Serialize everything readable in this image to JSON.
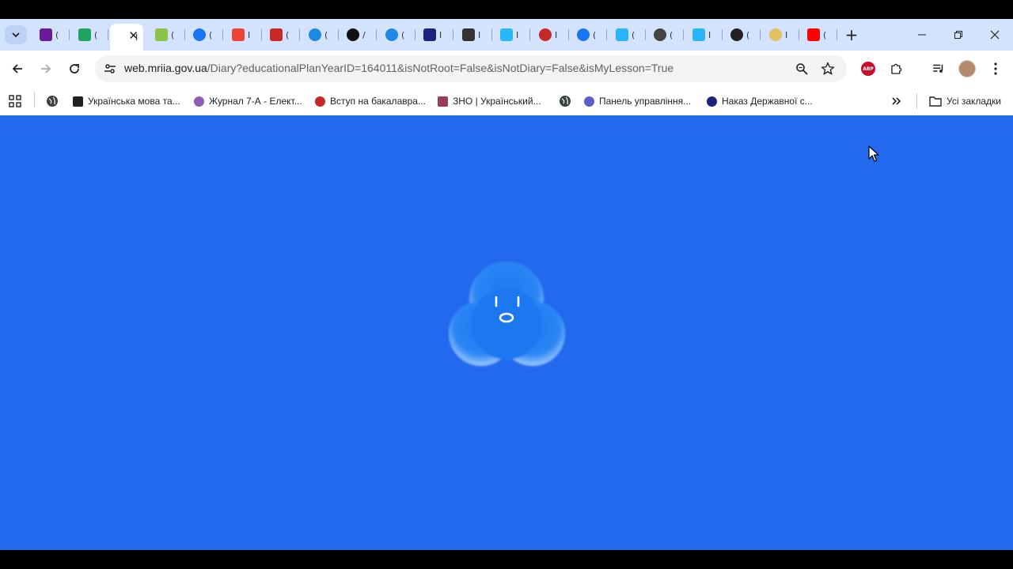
{
  "browser": {
    "tabs": [
      {
        "icon": "colorful-squares-icon",
        "color": "#6a1b9a",
        "frag": "("
      },
      {
        "icon": "green-plus-icon",
        "color": "#1ea362",
        "frag": "("
      },
      {
        "icon": "page-icon",
        "color": "#ffffff",
        "frag": "I",
        "active": true
      },
      {
        "icon": "folder-icon",
        "color": "#8bc34a",
        "frag": "("
      },
      {
        "icon": "facebook-icon",
        "color": "#1877f2",
        "frag": "("
      },
      {
        "icon": "gmail-icon",
        "color": "#ea4335",
        "frag": "I"
      },
      {
        "icon": "mail-icon",
        "color": "#c62828",
        "frag": "("
      },
      {
        "icon": "c-circle-icon",
        "color": "#1e88e5",
        "frag": "("
      },
      {
        "icon": "ai-icon",
        "color": "#111111",
        "frag": "/"
      },
      {
        "icon": "c-circle-icon",
        "color": "#1e88e5",
        "frag": "("
      },
      {
        "icon": "rada-icon",
        "color": "#1a237e",
        "frag": "I"
      },
      {
        "icon": "id-card-icon",
        "color": "#333333",
        "frag": "I"
      },
      {
        "icon": "grid-icon",
        "color": "#29b6f6",
        "frag": "I"
      },
      {
        "icon": "red-circle-icon",
        "color": "#c62828",
        "frag": "I"
      },
      {
        "icon": "facebook-icon",
        "color": "#1877f2",
        "frag": "("
      },
      {
        "icon": "grid-icon",
        "color": "#29b6f6",
        "frag": "("
      },
      {
        "icon": "chrome-icon",
        "color": "#444444",
        "frag": "("
      },
      {
        "icon": "grid-icon",
        "color": "#29b6f6",
        "frag": "I"
      },
      {
        "icon": "openai-icon",
        "color": "#222222",
        "frag": "("
      },
      {
        "icon": "chat-icon",
        "color": "#e0c060",
        "frag": "I"
      },
      {
        "icon": "youtube-icon",
        "color": "#ff0000",
        "frag": "("
      }
    ],
    "url_host": "web.mriia.gov.ua",
    "url_path": "/Diary?educationalPlanYearID=164011&isNotRoot=False&isNotDiary=False&isMyLesson=True",
    "abp_label": "ABP",
    "bookmarks": [
      {
        "label": "",
        "icon": "globe-icon"
      },
      {
        "label": "Українська мова та...",
        "icon": "graduation-cap-icon"
      },
      {
        "label": "Журнал 7-А - Елект...",
        "icon": "journal-icon"
      },
      {
        "label": "Вступ на бакалавра...",
        "icon": "red-emblem-icon"
      },
      {
        "label": "ЗНО | Український...",
        "icon": "flag-icon"
      },
      {
        "label": "",
        "icon": "globe-icon"
      },
      {
        "label": "Панель управління...",
        "icon": "teams-icon"
      },
      {
        "label": "Наказ Державної с...",
        "icon": "location-icon"
      }
    ],
    "all_bookmarks_label": "Усі закладки"
  }
}
